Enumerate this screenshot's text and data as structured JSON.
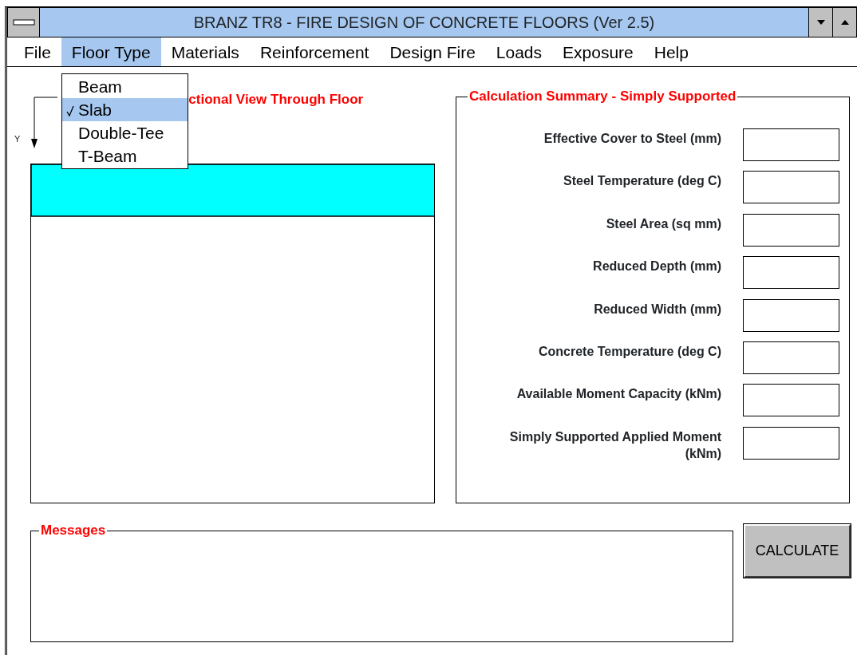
{
  "window": {
    "title": "BRANZ TR8 - FIRE DESIGN OF CONCRETE FLOORS (Ver 2.5)"
  },
  "menu": [
    {
      "label": "File",
      "selected": false
    },
    {
      "label": "Floor Type",
      "selected": true
    },
    {
      "label": "Materials",
      "selected": false
    },
    {
      "label": "Reinforcement",
      "selected": false
    },
    {
      "label": "Design Fire",
      "selected": false
    },
    {
      "label": "Loads",
      "selected": false
    },
    {
      "label": "Exposure",
      "selected": false
    },
    {
      "label": "Help",
      "selected": false
    }
  ],
  "dropdown": [
    {
      "label": "Beam",
      "checked": false,
      "selected": false
    },
    {
      "label": "Slab",
      "checked": true,
      "selected": true
    },
    {
      "label": "Double-Tee",
      "checked": false,
      "selected": false
    },
    {
      "label": "T-Beam",
      "checked": false,
      "selected": false
    }
  ],
  "section_view": {
    "caption": "ctional View Through Floor",
    "axis_label": "Y"
  },
  "summary": {
    "title": "Calculation Summary - Simply Supported",
    "fields": [
      {
        "label": "Effective Cover to Steel (mm)"
      },
      {
        "label": "Steel Temperature (deg C)"
      },
      {
        "label": "Steel Area (sq mm)"
      },
      {
        "label": "Reduced Depth (mm)"
      },
      {
        "label": "Reduced Width (mm)"
      },
      {
        "label": "Concrete Temperature (deg C)"
      },
      {
        "label": "Available Moment Capacity (kNm)"
      },
      {
        "label": "Simply Supported Applied Moment (kNm)"
      }
    ]
  },
  "messages": {
    "title": "Messages"
  },
  "calculate_button": "CALCULATE"
}
